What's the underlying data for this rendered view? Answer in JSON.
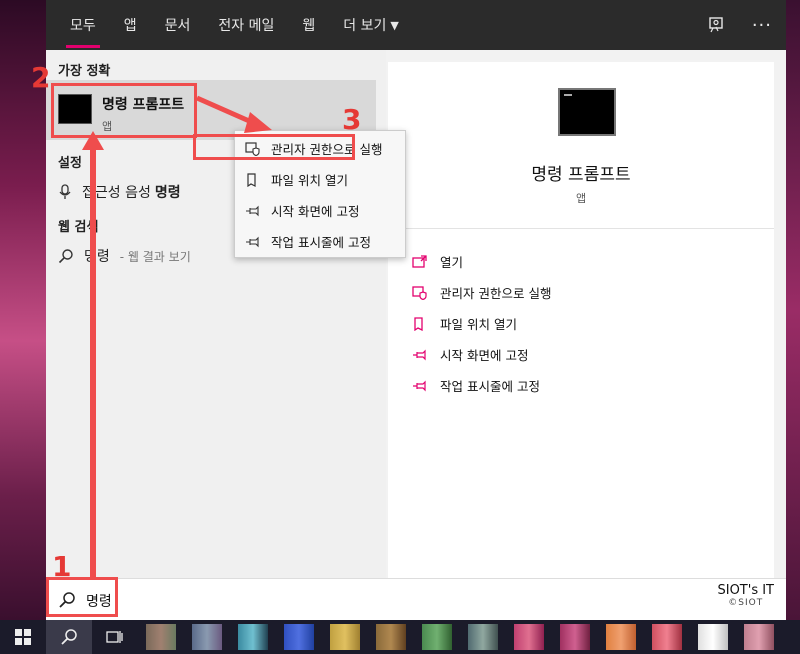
{
  "tabs": [
    {
      "label": "모두"
    },
    {
      "label": "앱"
    },
    {
      "label": "문서"
    },
    {
      "label": "전자 메일"
    },
    {
      "label": "웹"
    },
    {
      "label": "더 보기"
    }
  ],
  "left": {
    "best_match_title": "가장 정확",
    "best_match_name": "명령 프롬프트",
    "best_match_type": "앱",
    "settings_title": "설정",
    "settings_item_pre": "접근성 음성",
    "settings_item_bold": "명령",
    "web_title": "웹 검색",
    "web_item": "명령",
    "web_item_sub": "- 웹 결과 보기"
  },
  "context_menu": [
    {
      "label": "관리자 권한으로 실행",
      "icon": "shield-icon"
    },
    {
      "label": "파일 위치 열기",
      "icon": "folder-icon"
    },
    {
      "label": "시작 화면에 고정",
      "icon": "pin-icon"
    },
    {
      "label": "작업 표시줄에 고정",
      "icon": "pin-icon"
    }
  ],
  "detail": {
    "name": "명령 프롬프트",
    "type": "앱",
    "actions": [
      {
        "label": "열기",
        "icon": "open-icon"
      },
      {
        "label": "관리자 권한으로 실행",
        "icon": "shield-icon"
      },
      {
        "label": "파일 위치 열기",
        "icon": "folder-icon"
      },
      {
        "label": "시작 화면에 고정",
        "icon": "pin-icon"
      },
      {
        "label": "작업 표시줄에 고정",
        "icon": "pin-icon"
      }
    ]
  },
  "search": {
    "query": "명령"
  },
  "watermark": {
    "main": "SIOT's IT",
    "sub": "©SIOT"
  },
  "annotations": {
    "step1": "1",
    "step2": "2",
    "step3": "3"
  },
  "colors": {
    "accent": "#e3006e",
    "annotation": "#ef4d4d",
    "topbar": "#2b2b2b"
  }
}
